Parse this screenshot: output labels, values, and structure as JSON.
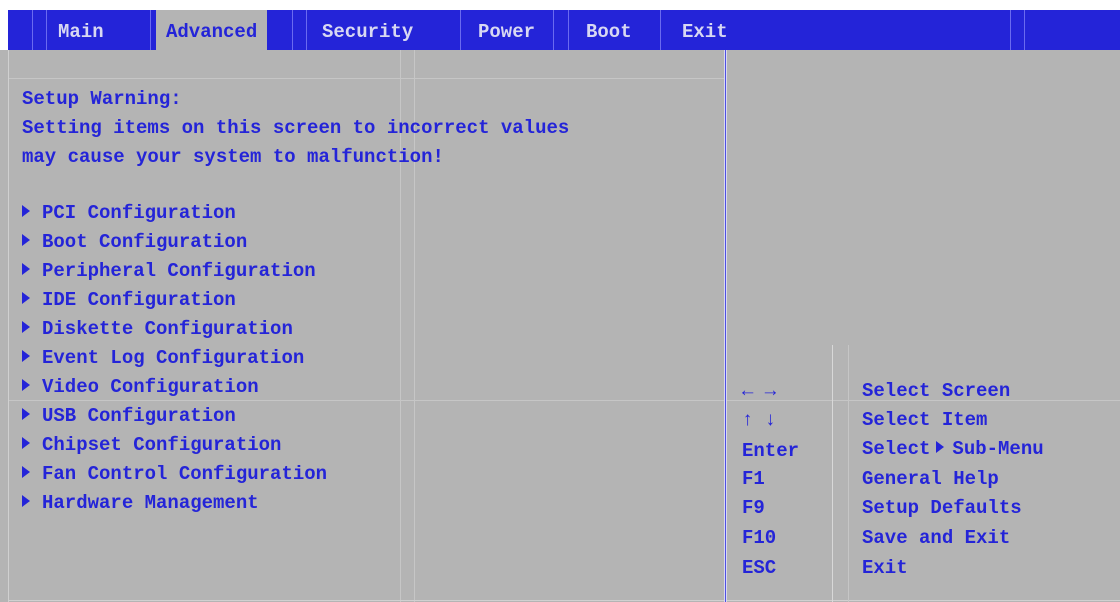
{
  "tabs": [
    {
      "label": "Main"
    },
    {
      "label": "Advanced"
    },
    {
      "label": "Security"
    },
    {
      "label": "Power"
    },
    {
      "label": "Boot"
    },
    {
      "label": "Exit"
    }
  ],
  "active_tab": "Advanced",
  "warning": {
    "title": "Setup Warning:",
    "line1": "Setting items on this screen to incorrect values",
    "line2": "may cause your system to malfunction!"
  },
  "menu_items": [
    {
      "label": "PCI Configuration"
    },
    {
      "label": "Boot Configuration"
    },
    {
      "label": "Peripheral Configuration"
    },
    {
      "label": "IDE Configuration"
    },
    {
      "label": "Diskette Configuration"
    },
    {
      "label": "Event Log Configuration"
    },
    {
      "label": "Video Configuration"
    },
    {
      "label": "USB Configuration"
    },
    {
      "label": "Chipset Configuration"
    },
    {
      "label": "Fan Control Configuration"
    },
    {
      "label": "Hardware Management"
    }
  ],
  "help_keys": [
    {
      "key": "← →",
      "desc": "Select Screen"
    },
    {
      "key": "↑ ↓",
      "desc": "Select Item"
    },
    {
      "key": "Enter",
      "desc_pre": "Select",
      "desc_post": "Sub-Menu"
    },
    {
      "key": "F1",
      "desc": "General Help"
    },
    {
      "key": "F9",
      "desc": "Setup Defaults"
    },
    {
      "key": "F10",
      "desc": "Save and Exit"
    },
    {
      "key": "ESC",
      "desc": "Exit"
    }
  ],
  "colors": {
    "background": "#b4b4b4",
    "text": "#2424d8",
    "tabbar": "#2424d8",
    "tab_text": "#d8d8f2"
  },
  "icons": {
    "submenu": "triangle-right-icon"
  }
}
